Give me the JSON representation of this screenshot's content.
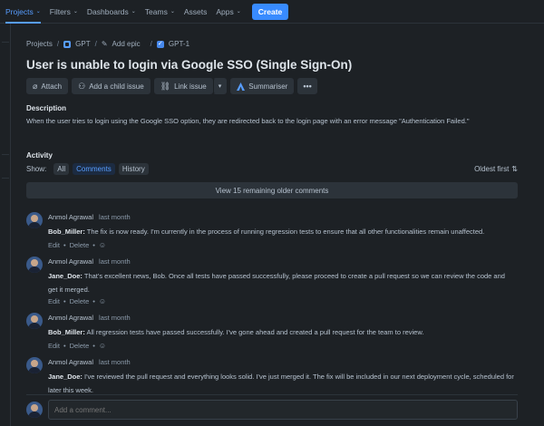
{
  "nav": {
    "items": [
      {
        "label": "Projects",
        "active": true,
        "chevron": true
      },
      {
        "label": "Filters",
        "chevron": true
      },
      {
        "label": "Dashboards",
        "chevron": true
      },
      {
        "label": "Teams",
        "chevron": true
      },
      {
        "label": "Assets",
        "chevron": false
      },
      {
        "label": "Apps",
        "chevron": true
      }
    ],
    "create": "Create",
    "accent": "#579dff"
  },
  "breadcrumb": {
    "projects": "Projects",
    "project": "GPT",
    "add_epic": "Add epic",
    "issue": "GPT-1"
  },
  "issue": {
    "title": "User is unable to login via Google SSO (Single Sign-On)"
  },
  "toolbar": {
    "attach": "Attach",
    "add_child": "Add a child issue",
    "link_issue": "Link issue",
    "summariser": "Summariser"
  },
  "description": {
    "heading": "Description",
    "text": "When the user tries to login using the Google SSO option, they are redirected back to the login page with an error message \"Authentication Failed.\""
  },
  "activity": {
    "heading": "Activity",
    "show_label": "Show:",
    "filters": [
      "All",
      "Comments",
      "History"
    ],
    "selected_filter": "Comments",
    "sort": "Oldest first",
    "older": "View 15 remaining older comments"
  },
  "comments": [
    {
      "author": "Anmol Agrawal",
      "time": "last month",
      "mention": "Bob_Miller:",
      "text": " The fix is now ready. I'm currently in the process of running regression tests to ensure that all other functionalities remain unaffected."
    },
    {
      "author": "Anmol Agrawal",
      "time": "last month",
      "mention": "Jane_Doe:",
      "text": " That's excellent news, Bob. Once all tests have passed successfully, please proceed to create a pull request so we can review the code and get it merged."
    },
    {
      "author": "Anmol Agrawal",
      "time": "last month",
      "mention": "Bob_Miller:",
      "text": " All regression tests have passed successfully. I've gone ahead and created a pull request for the team to review."
    },
    {
      "author": "Anmol Agrawal",
      "time": "last month",
      "mention": "Jane_Doe:",
      "text": " I've reviewed the pull request and everything looks solid. I've just merged it. The fix will be included in our next deployment cycle, scheduled for later this week."
    }
  ],
  "comment_actions": {
    "edit": "Edit",
    "delete": "Delete",
    "sep": "•"
  },
  "add_comment": {
    "placeholder": "Add a comment..."
  }
}
